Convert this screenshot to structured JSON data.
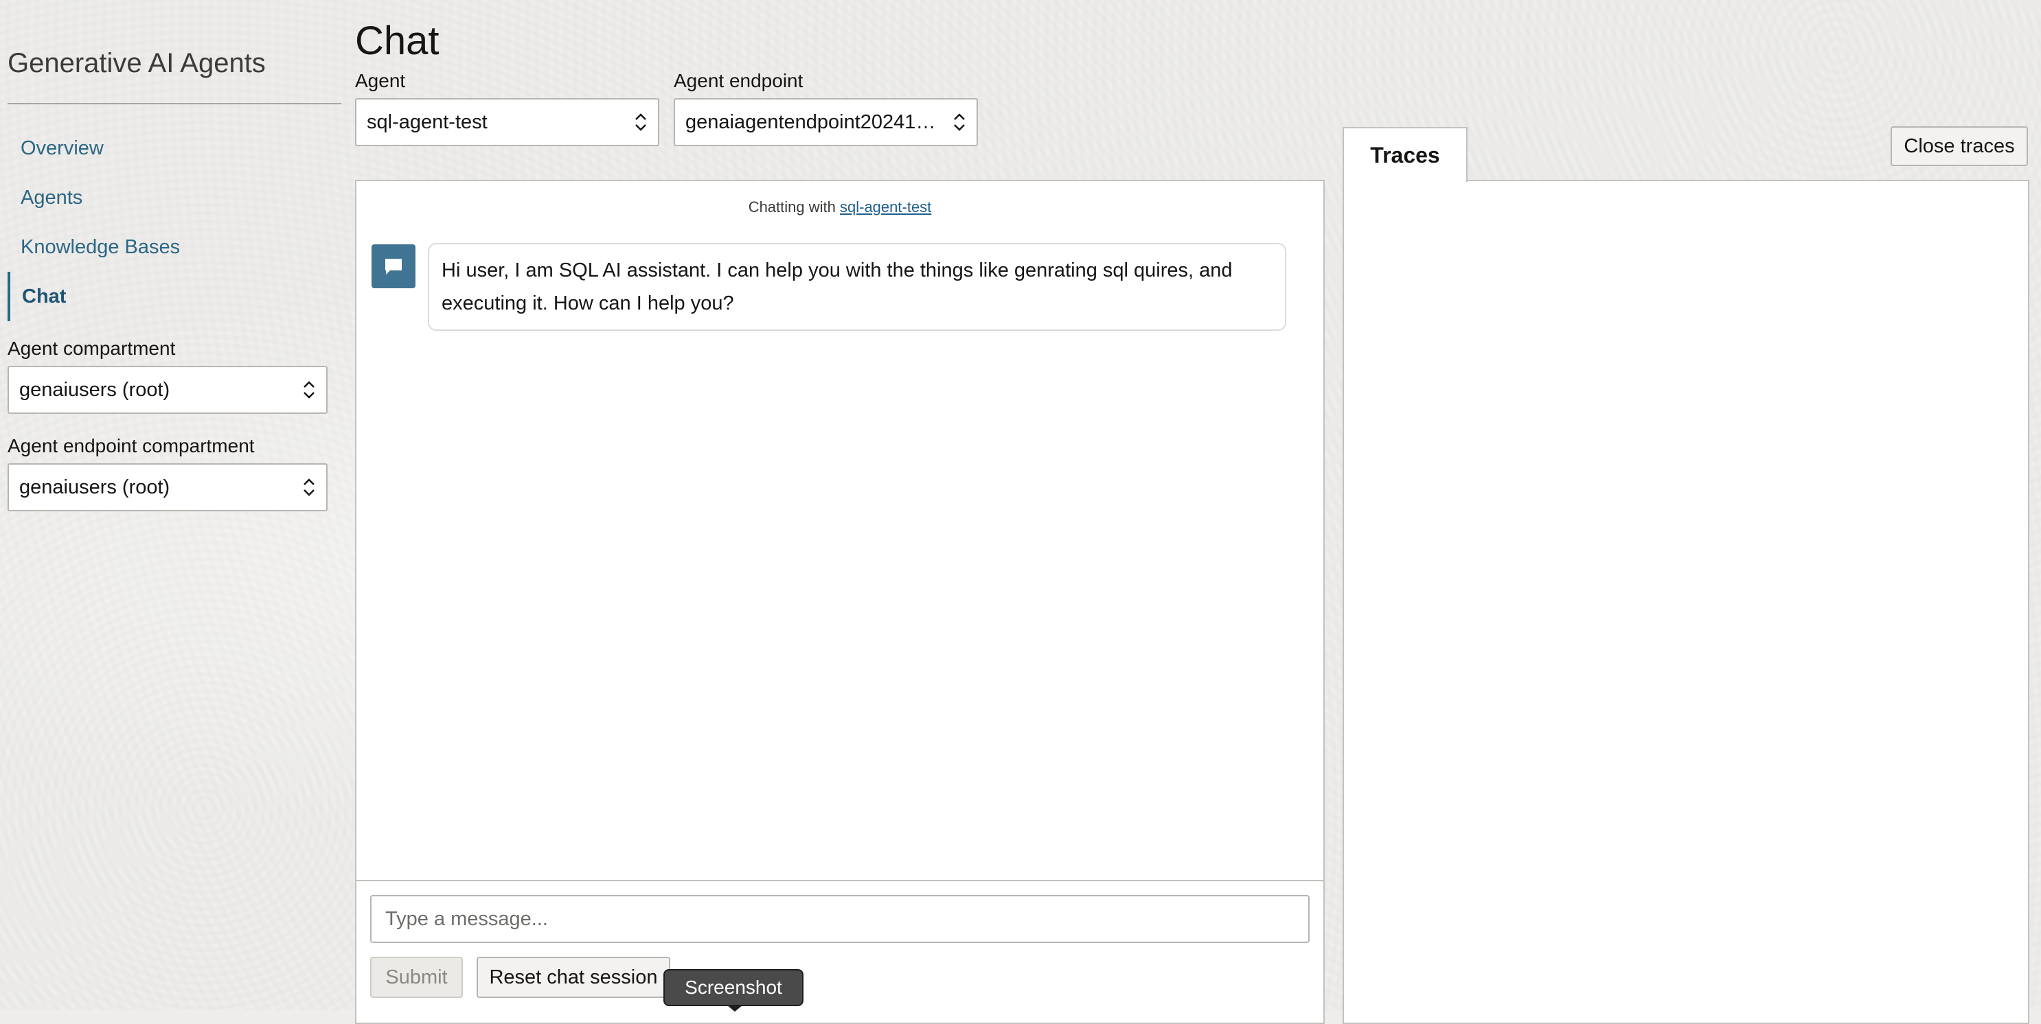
{
  "app": {
    "title": "Generative AI Agents"
  },
  "sidebar": {
    "items": [
      {
        "label": "Overview"
      },
      {
        "label": "Agents"
      },
      {
        "label": "Knowledge Bases"
      },
      {
        "label": "Chat",
        "active": true
      }
    ],
    "agent_compartment": {
      "label": "Agent compartment",
      "value": "genaiusers (root)"
    },
    "endpoint_compartment": {
      "label": "Agent endpoint compartment",
      "value": "genaiusers (root)"
    }
  },
  "header": {
    "title": "Chat",
    "agent": {
      "label": "Agent",
      "value": "sql-agent-test"
    },
    "endpoint": {
      "label": "Agent endpoint",
      "value": "genaiagentendpoint202412..."
    }
  },
  "chat": {
    "header_prefix": "Chatting with",
    "agent_link": "sql-agent-test",
    "messages": [
      {
        "sender": "agent",
        "icon": "chat-bubble-icon",
        "text": "Hi user, I am SQL AI assistant. I can help you with the things like genrating sql quires, and executing it. How can I help you?"
      }
    ],
    "input_placeholder": "Type a message...",
    "input_value": "",
    "submit_label": "Submit",
    "reset_label": "Reset chat session"
  },
  "traces": {
    "tab_label": "Traces",
    "close_label": "Close traces"
  },
  "tooltip": {
    "text": "Screenshot"
  },
  "colors": {
    "accent": "#2b6685",
    "avatar_bg": "#3f7593",
    "background": "#eeedeb"
  }
}
